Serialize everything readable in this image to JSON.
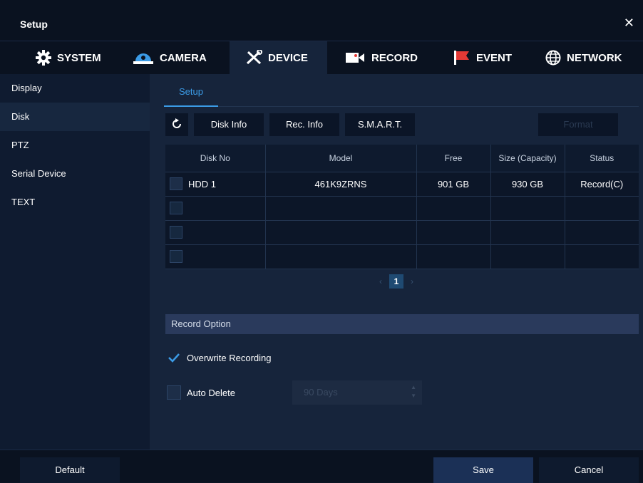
{
  "window": {
    "title": "Setup",
    "close_symbol": "✕"
  },
  "tabs": [
    {
      "label": "SYSTEM",
      "icon": "gear-icon"
    },
    {
      "label": "CAMERA",
      "icon": "dome-camera-icon"
    },
    {
      "label": "DEVICE",
      "icon": "tools-icon",
      "active": true
    },
    {
      "label": "RECORD",
      "icon": "video-camera-icon"
    },
    {
      "label": "EVENT",
      "icon": "flag-icon"
    },
    {
      "label": "NETWORK",
      "icon": "globe-icon"
    }
  ],
  "sidebar": {
    "items": [
      {
        "label": "Display"
      },
      {
        "label": "Disk",
        "active": true
      },
      {
        "label": "PTZ"
      },
      {
        "label": "Serial Device"
      },
      {
        "label": "TEXT"
      }
    ]
  },
  "main": {
    "subtab": "Setup",
    "toolbar": {
      "refresh_icon": "refresh-icon",
      "disk_info": "Disk Info",
      "rec_info": "Rec. Info",
      "smart": "S.M.A.R.T.",
      "format": "Format"
    },
    "table": {
      "headers": [
        "Disk No",
        "Model",
        "Free",
        "Size (Capacity)",
        "Status"
      ],
      "rows": [
        {
          "disk_no": "HDD 1",
          "model": "461K9ZRNS",
          "free": "901 GB",
          "size": "930 GB",
          "status": "Record(C)"
        },
        {
          "disk_no": "",
          "model": "",
          "free": "",
          "size": "",
          "status": ""
        },
        {
          "disk_no": "",
          "model": "",
          "free": "",
          "size": "",
          "status": ""
        },
        {
          "disk_no": "",
          "model": "",
          "free": "",
          "size": "",
          "status": ""
        }
      ]
    },
    "pagination": {
      "current": "1",
      "prev": "‹",
      "next": "›"
    },
    "record_option": {
      "title": "Record Option",
      "overwrite_label": "Overwrite Recording",
      "overwrite_checked": true,
      "auto_delete_label": "Auto Delete",
      "auto_delete_checked": false,
      "days_value": "90 Days"
    }
  },
  "footer": {
    "default": "Default",
    "save": "Save",
    "cancel": "Cancel"
  },
  "colors": {
    "accent": "#3b9be6",
    "active_tab": "#16243b",
    "section_header": "#2a3a5c",
    "save_button": "#1b3056"
  }
}
